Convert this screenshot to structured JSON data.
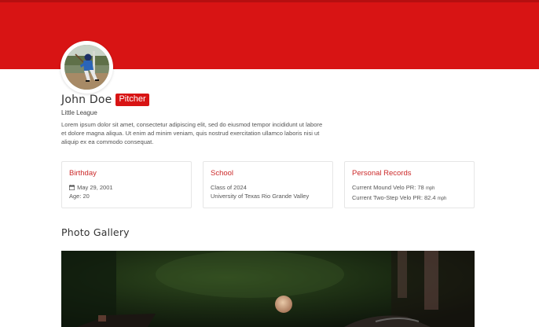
{
  "profile": {
    "name": "John Doe",
    "position_badge": "Pitcher",
    "league": "Little League",
    "bio": "Lorem ipsum dolor sit amet, consectetur adipiscing elit, sed do eiusmod tempor incididunt ut labore et dolore magna aliqua. Ut enim ad minim veniam, quis nostrud exercitation ullamco laboris nisi ut aliquip ex ea commodo consequat."
  },
  "cards": {
    "birthday": {
      "title": "Birthday",
      "date": "May 29, 2001",
      "age": "Age: 20",
      "icon": "calendar-icon"
    },
    "school": {
      "title": "School",
      "class": "Class of 2024",
      "name": "University of Texas Rio Grande Valley"
    },
    "records": {
      "title": "Personal Records",
      "mound_label": "Current Mound Velo PR: ",
      "mound_value": "78",
      "mound_unit": "mph",
      "twostep_label": "Current Two-Step Velo PR: ",
      "twostep_value": "82.4",
      "twostep_unit": "mph"
    }
  },
  "gallery": {
    "title": "Photo Gallery"
  },
  "colors": {
    "brand_red": "#d81414",
    "card_title": "#cc2a2a"
  }
}
